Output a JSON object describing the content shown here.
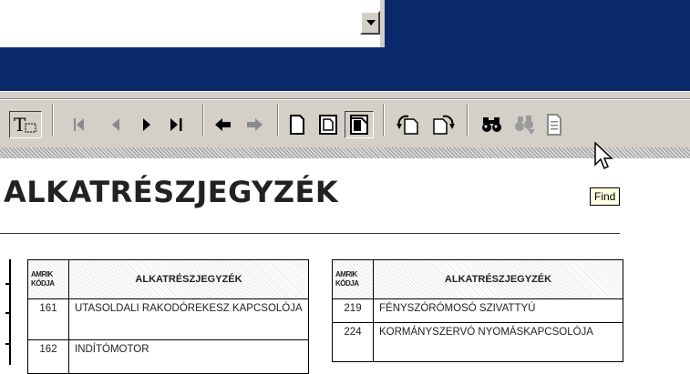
{
  "document": {
    "title": "ALKATRÉSZJEGYZÉK"
  },
  "tooltip": {
    "text": "Find"
  },
  "toolbar": {
    "icons": [
      "text-select-icon",
      "first-page-icon",
      "previous-page-icon",
      "next-page-icon",
      "last-page-icon",
      "go-back-icon",
      "go-forward-icon",
      "actual-size-icon",
      "fit-page-icon",
      "fit-width-icon",
      "rotate-left-icon",
      "rotate-right-icon",
      "find-icon",
      "find-next-icon",
      "page-icon"
    ]
  },
  "tables": [
    {
      "headers": {
        "code": "AMRIK KÓDJA",
        "name": "ALKATRÉSZJEGYZÉK"
      },
      "rows": [
        {
          "code": "161",
          "name": "UTASOLDALI RAKODÓREKESZ KAPCSOLÓJA"
        },
        {
          "code": "162",
          "name": "INDÍTÓMOTOR"
        }
      ]
    },
    {
      "headers": {
        "code": "AMRIK KÓDJA",
        "name": "ALKATRÉSZJEGYZÉK"
      },
      "rows": [
        {
          "code": "219",
          "name": "FÉNYSZÓRÓMOSÓ SZIVATTYÚ"
        },
        {
          "code": "224",
          "name": "KORMÁNYSZERVÓ NYOMÁSKAPCSOLÓJA"
        }
      ]
    }
  ],
  "colors": {
    "titlebar": "#0b2a6b",
    "toolbar": "#d4d0c8",
    "tooltip_bg": "#ffffe1"
  }
}
